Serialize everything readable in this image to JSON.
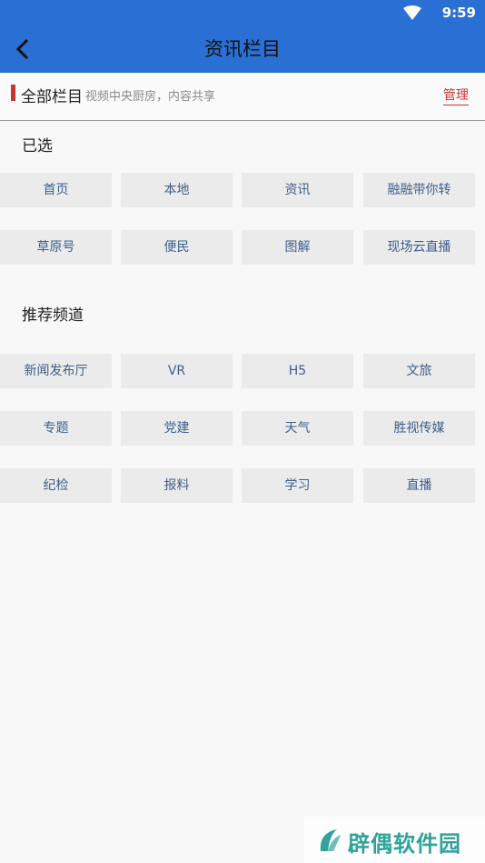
{
  "status_bar": {
    "time": "9:59"
  },
  "header": {
    "title": "资讯栏目"
  },
  "section_bar": {
    "label": "全部栏目",
    "description": "视频中央厨房，内容共享",
    "manage_label": "管理",
    "accent_color": "#c9342e"
  },
  "selected": {
    "title": "已选",
    "items": [
      "首页",
      "本地",
      "资讯",
      "融融带你转",
      "草原号",
      "便民",
      "图解",
      "现场云直播"
    ]
  },
  "recommended": {
    "title": "推荐频道",
    "items": [
      "新闻发布厅",
      "VR",
      "H5",
      "文旅",
      "专题",
      "党建",
      "天气",
      "胜视传媒",
      "纪检",
      "报料",
      "学习",
      "直播"
    ]
  },
  "watermark": {
    "text": "辟偶软件园"
  },
  "colors": {
    "app_bar": "#2a6fd4",
    "tile_bg": "#ebebeb",
    "tile_text": "#3c5f8a"
  }
}
